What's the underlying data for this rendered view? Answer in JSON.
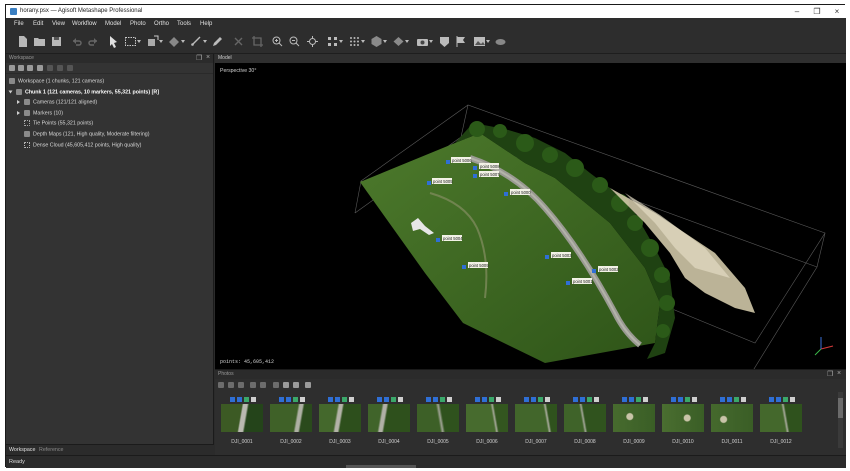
{
  "window": {
    "title": "horany.psx — Agisoft Metashape Professional"
  },
  "menu": [
    "File",
    "Edit",
    "View",
    "Workflow",
    "Model",
    "Photo",
    "Ortho",
    "Tools",
    "Help"
  ],
  "workspace_panel": {
    "title": "Workspace",
    "tree": [
      {
        "label": "Workspace (1 chunks, 121 cameras)",
        "level": 0,
        "bold": false
      },
      {
        "label": "Chunk 1 (121 cameras, 10 markers, 55,321 points) [R]",
        "level": 0,
        "bold": true
      },
      {
        "label": "Cameras (121/121 aligned)",
        "level": 1,
        "bold": false
      },
      {
        "label": "Markers (10)",
        "level": 1,
        "bold": false
      },
      {
        "label": "Tie Points (55,321 points)",
        "level": 1,
        "bold": false
      },
      {
        "label": "Depth Maps (121, High quality, Moderate filtering)",
        "level": 1,
        "bold": false
      },
      {
        "label": "Dense Cloud (45,605,412 points, High quality)",
        "level": 1,
        "bold": false
      }
    ],
    "tabs": [
      "Workspace",
      "Reference"
    ]
  },
  "model_view": {
    "title": "Model",
    "perspective": "Perspective 30°",
    "points_readout": "points: 45,605,412",
    "markers": [
      "point 5006",
      "point 5008",
      "point 5007",
      "point 5005",
      "point 5000",
      "point 5004",
      "point 5009",
      "point 5003",
      "point 5002",
      "point 5001"
    ]
  },
  "photos_panel": {
    "title": "Photos",
    "thumbnails": [
      "DJI_0001",
      "DJI_0002",
      "DJI_0003",
      "DJI_0004",
      "DJI_0005",
      "DJI_0006",
      "DJI_0007",
      "DJI_0008",
      "DJI_0009",
      "DJI_0010",
      "DJI_0011",
      "DJI_0012"
    ]
  },
  "status": {
    "text": "Ready"
  },
  "colors": {
    "background": "#2b2b2b",
    "panel": "#333333",
    "marker_blue": "#2f6fd6",
    "vegetation": "#3f6a25",
    "sand": "#d9d2b6"
  }
}
